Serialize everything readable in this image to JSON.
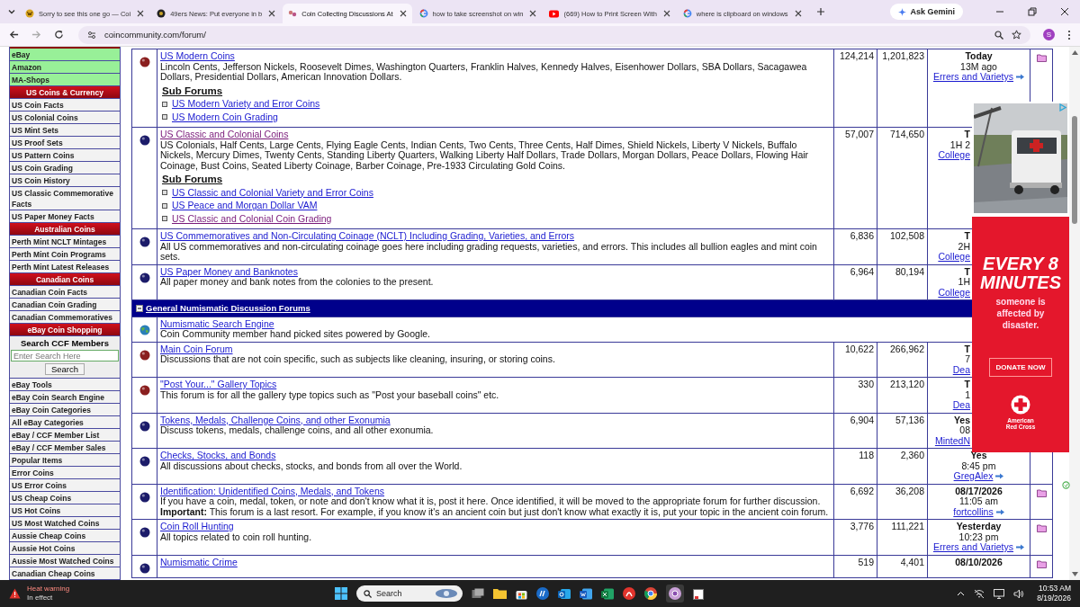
{
  "browser": {
    "tabs": [
      {
        "title": "Sorry to see this one go — Coi",
        "selected": false
      },
      {
        "title": "49ers News: Put everyone in b",
        "selected": false
      },
      {
        "title": "Coin Collecting Discussions At",
        "selected": true
      },
      {
        "title": "how to take screenshot on win",
        "selected": false
      },
      {
        "title": "(669) How to Print Screen With",
        "selected": false
      },
      {
        "title": "where is clipboard on windows",
        "selected": false
      }
    ],
    "gemini": "Ask Gemini",
    "url": "coincommunity.com/forum/",
    "profile": "S"
  },
  "sidebar": [
    {
      "kind": "shop",
      "label": "eBay"
    },
    {
      "kind": "shop",
      "label": "Amazon"
    },
    {
      "kind": "shop",
      "label": "MA-Shops"
    },
    {
      "kind": "header",
      "label": "US Coins & Currency"
    },
    {
      "kind": "link",
      "label": "US Coin Facts"
    },
    {
      "kind": "link",
      "label": "US Colonial Coins"
    },
    {
      "kind": "link",
      "label": "US Mint Sets"
    },
    {
      "kind": "link",
      "label": "US Proof Sets"
    },
    {
      "kind": "link",
      "label": "US Pattern Coins"
    },
    {
      "kind": "link",
      "label": "US Coin Grading"
    },
    {
      "kind": "link",
      "label": "US Coin History"
    },
    {
      "kind": "link",
      "label": "US Classic Commemorative Facts"
    },
    {
      "kind": "link",
      "label": "US Paper Money Facts"
    },
    {
      "kind": "header",
      "label": "Australian Coins"
    },
    {
      "kind": "link",
      "label": "Perth Mint NCLT Mintages"
    },
    {
      "kind": "link",
      "label": "Perth Mint Coin Programs"
    },
    {
      "kind": "link",
      "label": "Perth Mint Latest Releases"
    },
    {
      "kind": "header",
      "label": "Canadian Coins"
    },
    {
      "kind": "link",
      "label": "Canadian Coin Facts"
    },
    {
      "kind": "link",
      "label": "Canadian Coin Grading"
    },
    {
      "kind": "link",
      "label": "Canadian Commemoratives"
    },
    {
      "kind": "header",
      "label": "eBay Coin Shopping"
    },
    {
      "kind": "search",
      "label": "Search CCF Members",
      "placeholder": "Enter Search Here",
      "button": "Search"
    },
    {
      "kind": "link",
      "label": "eBay Tools"
    },
    {
      "kind": "link",
      "label": "eBay Coin Search Engine"
    },
    {
      "kind": "link",
      "label": "eBay Coin Categories"
    },
    {
      "kind": "link",
      "label": "All eBay Categories"
    },
    {
      "kind": "link",
      "label": "eBay / CCF Member List"
    },
    {
      "kind": "link",
      "label": "eBay / CCF Member Sales"
    },
    {
      "kind": "link",
      "label": "Popular Items"
    },
    {
      "kind": "link",
      "label": "Error Coins"
    },
    {
      "kind": "link",
      "label": "US Error Coins"
    },
    {
      "kind": "link",
      "label": "US Cheap Coins"
    },
    {
      "kind": "link",
      "label": "US Hot Coins"
    },
    {
      "kind": "link",
      "label": "US Most Watched Coins"
    },
    {
      "kind": "link",
      "label": "Aussie Cheap Coins"
    },
    {
      "kind": "link",
      "label": "Aussie Hot Coins"
    },
    {
      "kind": "link",
      "label": "Aussie Most Watched Coins"
    },
    {
      "kind": "link",
      "label": "Canadian Cheap Coins"
    }
  ],
  "sections": [
    {
      "rows": [
        {
          "kind": "new",
          "title": "US Modern Coins",
          "visited": false,
          "description": "Lincoln Cents, Jefferson Nickels, Roosevelt Dimes, Washington Quarters, Franklin Halves, Kennedy Halves, Eisenhower Dollars, SBA Dollars, Sacagawea Dollars, Presidential Dollars, American Innovation Dollars.",
          "sub_forums_label": "Sub Forums",
          "sub_forums": [
            {
              "title": "US Modern Variety and Error Coins",
              "visited": false
            },
            {
              "title": "US Modern Coin Grading",
              "visited": false
            }
          ],
          "topics": "124,214",
          "posts": "1,201,823",
          "last_post": {
            "date": "Today",
            "time": "13M ago",
            "user": "Errers and Varietys"
          },
          "new_posts": true
        },
        {
          "kind": "read",
          "title": "US Classic and Colonial Coins",
          "visited": true,
          "description": "US Colonials, Half Cents, Large Cents, Flying Eagle Cents, Indian Cents, Two Cents, Three Cents, Half Dimes, Shield Nickels, Liberty V Nickels, Buffalo Nickels, Mercury Dimes, Twenty Cents, Standing Liberty Quarters, Walking Liberty Half Dollars, Trade Dollars, Morgan Dollars, Peace Dollars, Flowing Hair Coinage, Bust Coins, Seated Liberty Coinage, Barber Coinage, Pre-1933 Circulating Gold Coins.",
          "sub_forums_label": "Sub Forums",
          "sub_forums": [
            {
              "title": "US Classic and Colonial Variety and Error Coins",
              "visited": false
            },
            {
              "title": "US Peace and Morgan Dollar VAM",
              "visited": false
            },
            {
              "title": "US Classic and Colonial Coin Grading",
              "visited": true
            }
          ],
          "topics": "57,007",
          "posts": "714,650",
          "last_post": {
            "date": "T",
            "time": "1H 2",
            "user": "College"
          },
          "new_posts": false
        },
        {
          "kind": "read",
          "title": "US Commemoratives and Non-Circulating Coinage (NCLT) Including Grading, Varieties, and Errors",
          "visited": false,
          "description": "All US commemoratives and non-circulating coinage goes here including grading requests, varieties, and errors. This includes all bullion eagles and mint coin sets.",
          "topics": "6,836",
          "posts": "102,508",
          "last_post": {
            "date": "T",
            "time": "2H",
            "user": "College"
          },
          "new_posts": false
        },
        {
          "kind": "read",
          "title": "US Paper Money and Banknotes",
          "visited": false,
          "description": "All paper money and bank notes from the colonies to the present.",
          "topics": "6,964",
          "posts": "80,194",
          "last_post": {
            "date": "T",
            "time": "1H",
            "user": "College"
          },
          "new_posts": false
        }
      ]
    },
    {
      "title": "General Numismatic Discussion Forums",
      "expanded": true,
      "rows": [
        {
          "kind": "link",
          "title": "Numismatic Search Engine",
          "visited": false,
          "description": "Coin Community member hand picked sites powered by Google."
        },
        {
          "kind": "new",
          "title": "Main Coin Forum",
          "visited": false,
          "description": "Discussions that are not coin specific, such as subjects like cleaning, insuring, or storing coins.",
          "topics": "10,622",
          "posts": "266,962",
          "last_post": {
            "date": "T",
            "time": "7",
            "user": "Dea"
          },
          "new_posts": false
        },
        {
          "kind": "new",
          "title": "\"Post Your...\" Gallery Topics",
          "visited": false,
          "description": "This forum is for all the gallery type topics such as \"Post your baseball coins\" etc.",
          "topics": "330",
          "posts": "213,120",
          "last_post": {
            "date": "T",
            "time": "1",
            "user": "Dea"
          },
          "new_posts": false
        },
        {
          "kind": "read",
          "title": "Tokens, Medals, Challenge Coins, and other Exonumia",
          "visited": false,
          "description": "Discuss tokens, medals, challenge coins, and all other exonumia.",
          "topics": "6,904",
          "posts": "57,136",
          "last_post": {
            "date": "Yes",
            "time": "08",
            "user": "MintedN"
          },
          "new_posts": false
        },
        {
          "kind": "read",
          "title": "Checks, Stocks, and Bonds",
          "visited": false,
          "description": "All discussions about checks, stocks, and bonds from all over the World.",
          "topics": "118",
          "posts": "2,360",
          "last_post": {
            "date": "Yes",
            "time": "8:45 pm",
            "user": "GregAlex"
          },
          "new_posts": false
        },
        {
          "kind": "read",
          "title": "Identification: Unidentified Coins, Medals, and Tokens",
          "visited": false,
          "description": "If you have a coin, medal, token, or note and don't know what it is, post it here. Once identified, it will be moved to the appropriate forum for further discussion. **Important:** This forum is a last resort. For example, if you know it's an ancient coin but just don't know what exactly it is, put your topic in the ancient coin forum.",
          "topics": "6,692",
          "posts": "36,208",
          "last_post": {
            "date": "08/17/2026",
            "time": "11:05 am",
            "user": "fortcollins"
          },
          "new_posts": true
        },
        {
          "kind": "read",
          "title": "Coin Roll Hunting",
          "visited": false,
          "description": "All topics related to coin roll hunting.",
          "topics": "3,776",
          "posts": "111,221",
          "last_post": {
            "date": "Yesterday",
            "time": "10:23 pm",
            "user": "Errers and Varietys"
          },
          "new_posts": true
        },
        {
          "kind": "read",
          "title": "Numismatic Crime",
          "visited": false,
          "topics": "519",
          "posts": "4,401",
          "last_post": {
            "date": "08/10/2026"
          },
          "new_posts": true
        }
      ]
    }
  ],
  "ad": {
    "headline": "EVERY 8 MINUTES",
    "body": "someone is affected by disaster.",
    "button": "DONATE NOW",
    "brand": "American Red Cross"
  },
  "taskbar": {
    "alert_title": "Heat warning",
    "alert_subtitle": "In effect",
    "search_placeholder": "Search",
    "time": "10:53 AM",
    "date": "8/19/2026"
  }
}
